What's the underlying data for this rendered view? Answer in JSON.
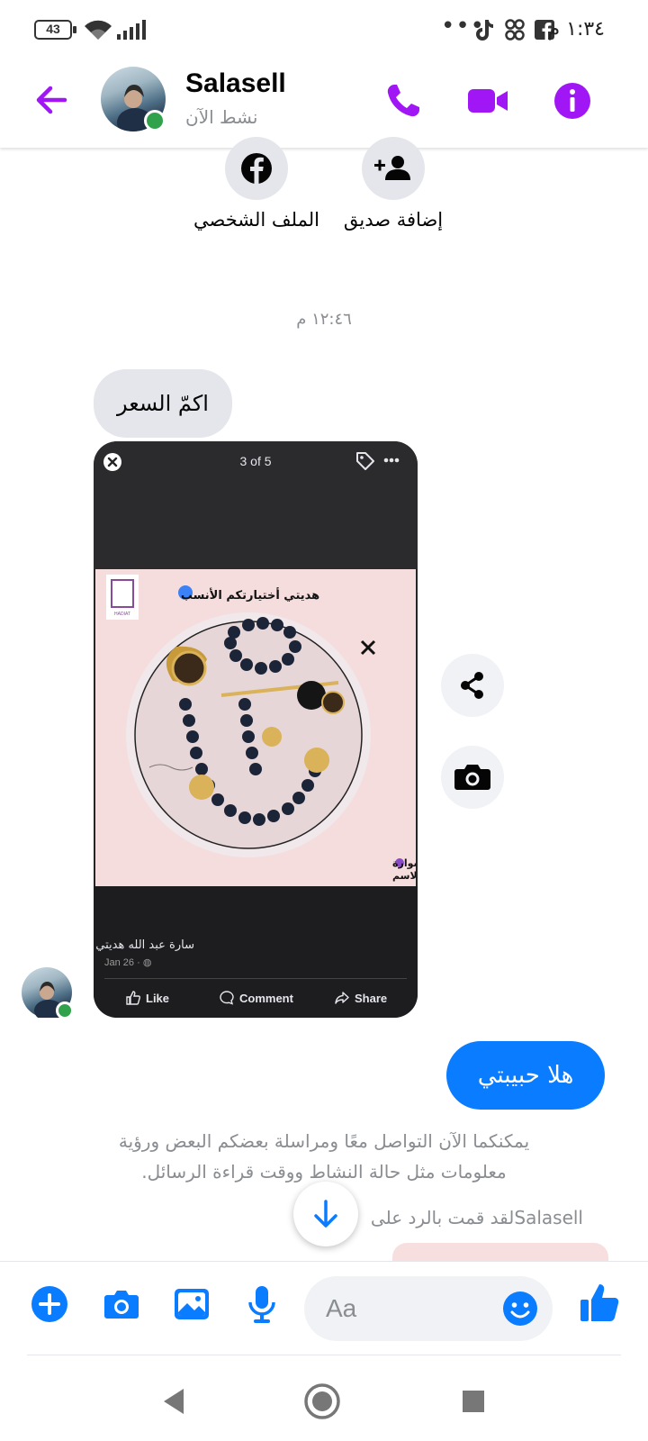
{
  "status_bar": {
    "battery": "43",
    "time": "١:٣٤ م",
    "dots": "•••"
  },
  "header": {
    "name": "Salasell",
    "status": "نشط الآن"
  },
  "profile_actions": {
    "profile_label": "الملف الشخصي",
    "add_friend_label": "إضافة صديق"
  },
  "conversation": {
    "timestamp": "١٢:٤٦ م",
    "incoming_message": "اكمّ السعر",
    "outgoing_message": "هلا حبيبتي",
    "info_line1": "يمكنكما الآن التواصل معًا ومراسلة بعضكم البعض ورؤية",
    "info_line2": "معلومات مثل حالة النشاط ووقت قراءة الرسائل.",
    "reply_note": "Salasellلقد قمت بالرد على"
  },
  "shared_post": {
    "counter": "3 of 5",
    "image_caption_top": "هديتي أختيارتكم الأنسب",
    "image_caption_bottom_1": "بكج البيبي لصاي وسوارة",
    "image_caption_bottom_2": "ودبوس بالاسم",
    "logo_text": "HADIAT",
    "author": "سارة عبد الله هديتي",
    "date": "Jan 26 · ",
    "like": "Like",
    "comment": "Comment",
    "share": "Share"
  },
  "composer": {
    "placeholder": "Aa"
  },
  "colors": {
    "accent_purple": "#a116f5",
    "messenger_blue": "#0a7cff",
    "online_green": "#31a24c"
  },
  "icons": [
    "back-arrow-icon",
    "phone-icon",
    "video-icon",
    "info-icon",
    "facebook-icon",
    "add-friend-icon",
    "share-icon",
    "camera-icon",
    "plus-icon",
    "image-icon",
    "mic-icon",
    "emoji-icon",
    "like-icon",
    "arrow-down-icon"
  ]
}
